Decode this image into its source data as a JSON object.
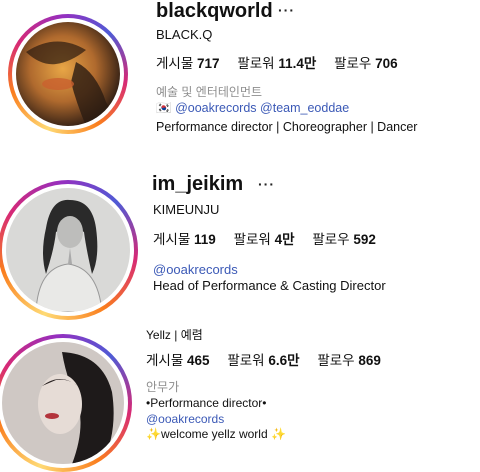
{
  "profiles": [
    {
      "username": "blackqworld",
      "more_icon": "···",
      "display_name": "BLACK.Q",
      "stats": [
        {
          "label": "게시물",
          "value": "717"
        },
        {
          "label": "팔로워",
          "value": "11.4만"
        },
        {
          "label": "팔로우",
          "value": "706"
        }
      ],
      "category": "예술 및 엔터테인먼트",
      "flag": "🇰🇷",
      "links": [
        "@ooakrecords",
        "@team_eoddae"
      ],
      "bio": "Performance director | Choreographer | Dancer"
    },
    {
      "username": "im_jeikim",
      "more_icon": "···",
      "display_name": "KIMEUNJU",
      "stats": [
        {
          "label": "게시물",
          "value": "119"
        },
        {
          "label": "팔로워",
          "value": "4만"
        },
        {
          "label": "팔로우",
          "value": "592"
        }
      ],
      "link": "@ooakrecords",
      "bio": "Head of Performance & Casting Director"
    },
    {
      "display_name": "Yellz | 예렴",
      "stats": [
        {
          "label": "게시물",
          "value": "465"
        },
        {
          "label": "팔로워",
          "value": "6.6만"
        },
        {
          "label": "팔로우",
          "value": "869"
        }
      ],
      "category": "안무가",
      "bio_line1": "•Performance director•",
      "link": "@ooakrecords",
      "bio_line3": "✨welcome yellz world ✨"
    }
  ]
}
